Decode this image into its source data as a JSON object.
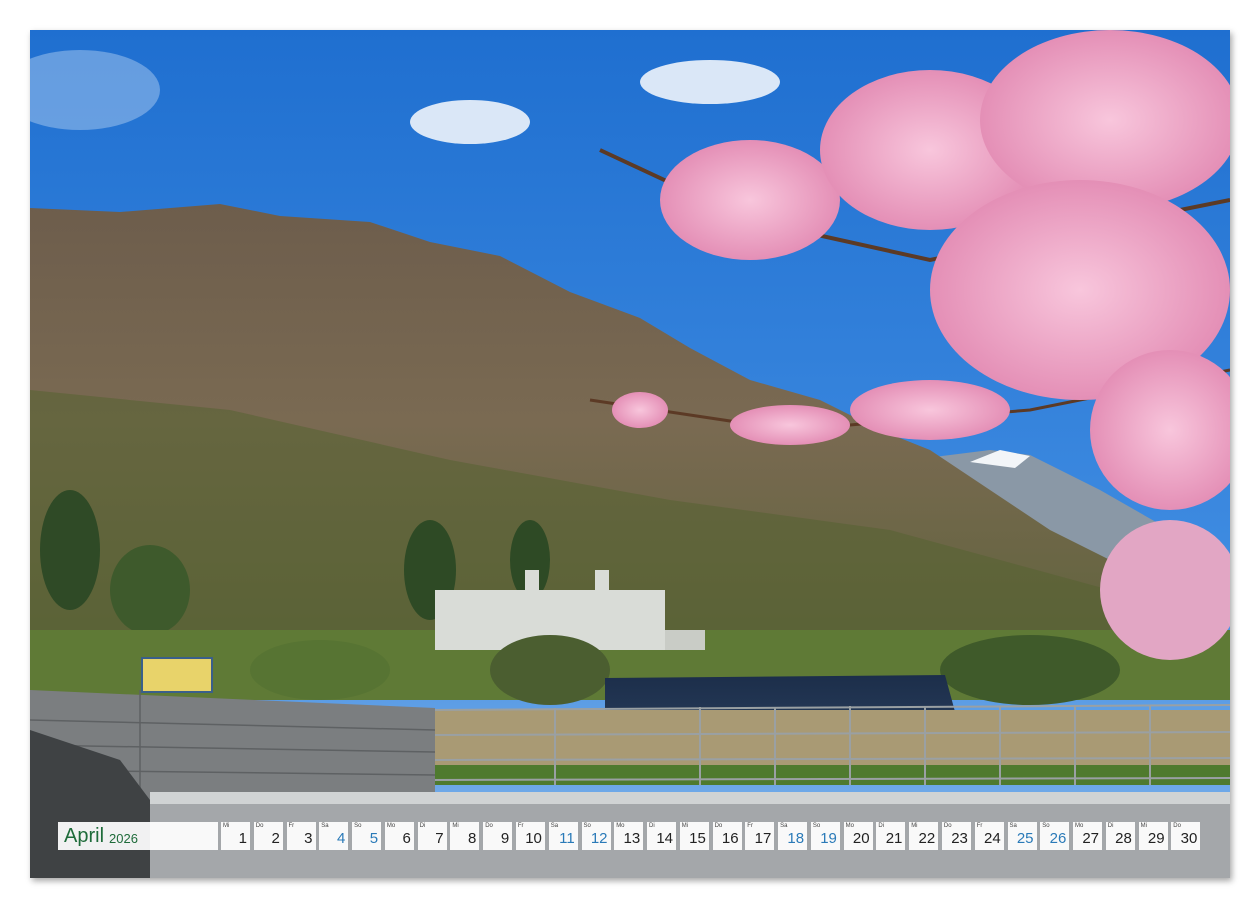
{
  "calendar": {
    "month": "April",
    "year": "2026",
    "days": [
      {
        "weekday": "Mi",
        "day": "1",
        "type": "weekday"
      },
      {
        "weekday": "Do",
        "day": "2",
        "type": "weekday"
      },
      {
        "weekday": "Fr",
        "day": "3",
        "type": "weekday"
      },
      {
        "weekday": "Sa",
        "day": "4",
        "type": "sat"
      },
      {
        "weekday": "So",
        "day": "5",
        "type": "sun"
      },
      {
        "weekday": "Mo",
        "day": "6",
        "type": "weekday"
      },
      {
        "weekday": "Di",
        "day": "7",
        "type": "weekday"
      },
      {
        "weekday": "Mi",
        "day": "8",
        "type": "weekday"
      },
      {
        "weekday": "Do",
        "day": "9",
        "type": "weekday"
      },
      {
        "weekday": "Fr",
        "day": "10",
        "type": "weekday"
      },
      {
        "weekday": "Sa",
        "day": "11",
        "type": "sat"
      },
      {
        "weekday": "So",
        "day": "12",
        "type": "sun"
      },
      {
        "weekday": "Mo",
        "day": "13",
        "type": "weekday"
      },
      {
        "weekday": "Di",
        "day": "14",
        "type": "weekday"
      },
      {
        "weekday": "Mi",
        "day": "15",
        "type": "weekday"
      },
      {
        "weekday": "Do",
        "day": "16",
        "type": "weekday"
      },
      {
        "weekday": "Fr",
        "day": "17",
        "type": "weekday"
      },
      {
        "weekday": "Sa",
        "day": "18",
        "type": "sat"
      },
      {
        "weekday": "So",
        "day": "19",
        "type": "sun"
      },
      {
        "weekday": "Mo",
        "day": "20",
        "type": "weekday"
      },
      {
        "weekday": "Di",
        "day": "21",
        "type": "weekday"
      },
      {
        "weekday": "Mi",
        "day": "22",
        "type": "weekday"
      },
      {
        "weekday": "Do",
        "day": "23",
        "type": "weekday"
      },
      {
        "weekday": "Fr",
        "day": "24",
        "type": "weekday"
      },
      {
        "weekday": "Sa",
        "day": "25",
        "type": "sat"
      },
      {
        "weekday": "So",
        "day": "26",
        "type": "sun"
      },
      {
        "weekday": "Mo",
        "day": "27",
        "type": "weekday"
      },
      {
        "weekday": "Di",
        "day": "28",
        "type": "weekday"
      },
      {
        "weekday": "Mi",
        "day": "29",
        "type": "weekday"
      },
      {
        "weekday": "Do",
        "day": "30",
        "type": "weekday"
      }
    ]
  },
  "colors": {
    "month_text": "#1e6b3a",
    "weekend_text": "#2a7ab8",
    "sky": "#2f7fd6",
    "blossom": "#f0a8c8"
  }
}
